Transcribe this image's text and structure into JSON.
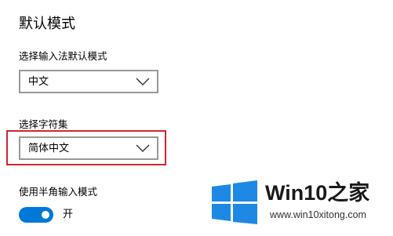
{
  "section": {
    "title": "默认模式"
  },
  "input_method_default": {
    "label": "选择输入法默认模式",
    "selected": "中文"
  },
  "charset": {
    "label": "选择字符集",
    "selected": "简体中文"
  },
  "halfwidth": {
    "label": "使用半角输入模式",
    "state_label": "开",
    "enabled": true
  },
  "watermark": {
    "brand_prefix": "Win10",
    "brand_suffix": "之家",
    "url": "www.win10xitong.com"
  },
  "colors": {
    "accent": "#0078d7",
    "highlight": "#d0262e",
    "logo": "#1e88e5"
  },
  "icons": {
    "dropdown": "chevron-down-icon",
    "logo": "windows-logo-icon"
  }
}
